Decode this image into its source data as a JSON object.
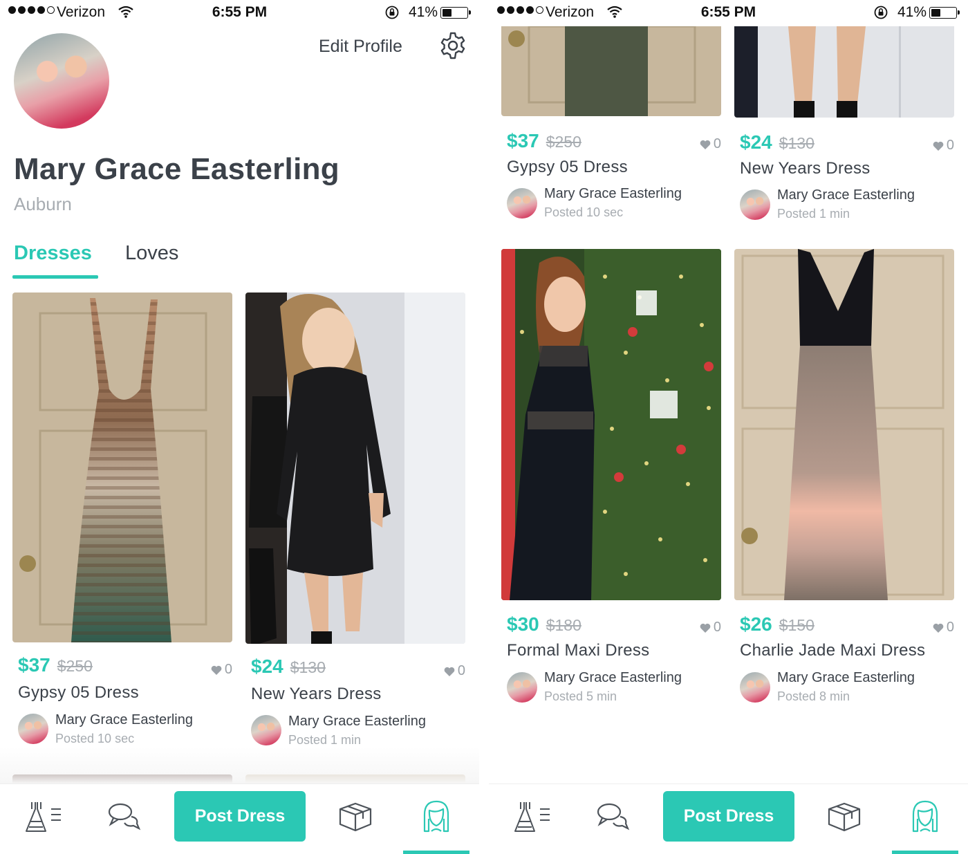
{
  "status_bar": {
    "carrier": "Verizon",
    "time": "6:55 PM",
    "battery": "41%",
    "battery_level": 0.41,
    "signal_bars_filled": 4,
    "signal_bars_total": 5
  },
  "profile": {
    "name": "Mary Grace Easterling",
    "location": "Auburn",
    "edit_label": "Edit Profile"
  },
  "tabs": {
    "dresses": "Dresses",
    "loves": "Loves"
  },
  "listings": [
    {
      "price": "$37",
      "original_price": "$250",
      "likes": "0",
      "title": "Gypsy 05 Dress",
      "seller": "Mary Grace Easterling",
      "posted": "Posted 10 sec"
    },
    {
      "price": "$24",
      "original_price": "$130",
      "likes": "0",
      "title": "New Years Dress",
      "seller": "Mary Grace Easterling",
      "posted": "Posted 1 min"
    },
    {
      "price": "$30",
      "original_price": "$180",
      "likes": "0",
      "title": "Formal Maxi Dress",
      "seller": "Mary Grace Easterling",
      "posted": "Posted 5 min"
    },
    {
      "price": "$26",
      "original_price": "$150",
      "likes": "0",
      "title": "Charlie Jade Maxi Dress",
      "seller": "Mary Grace Easterling",
      "posted": "Posted 8 min"
    }
  ],
  "tabbar": {
    "post_label": "Post Dress",
    "icons": [
      "dresses-list-icon",
      "chat-icon",
      "package-icon",
      "profile-icon"
    ],
    "active": "profile-icon"
  },
  "colors": {
    "accent": "#2bc8b4",
    "text": "#3b4149",
    "muted": "#a7acb1"
  }
}
